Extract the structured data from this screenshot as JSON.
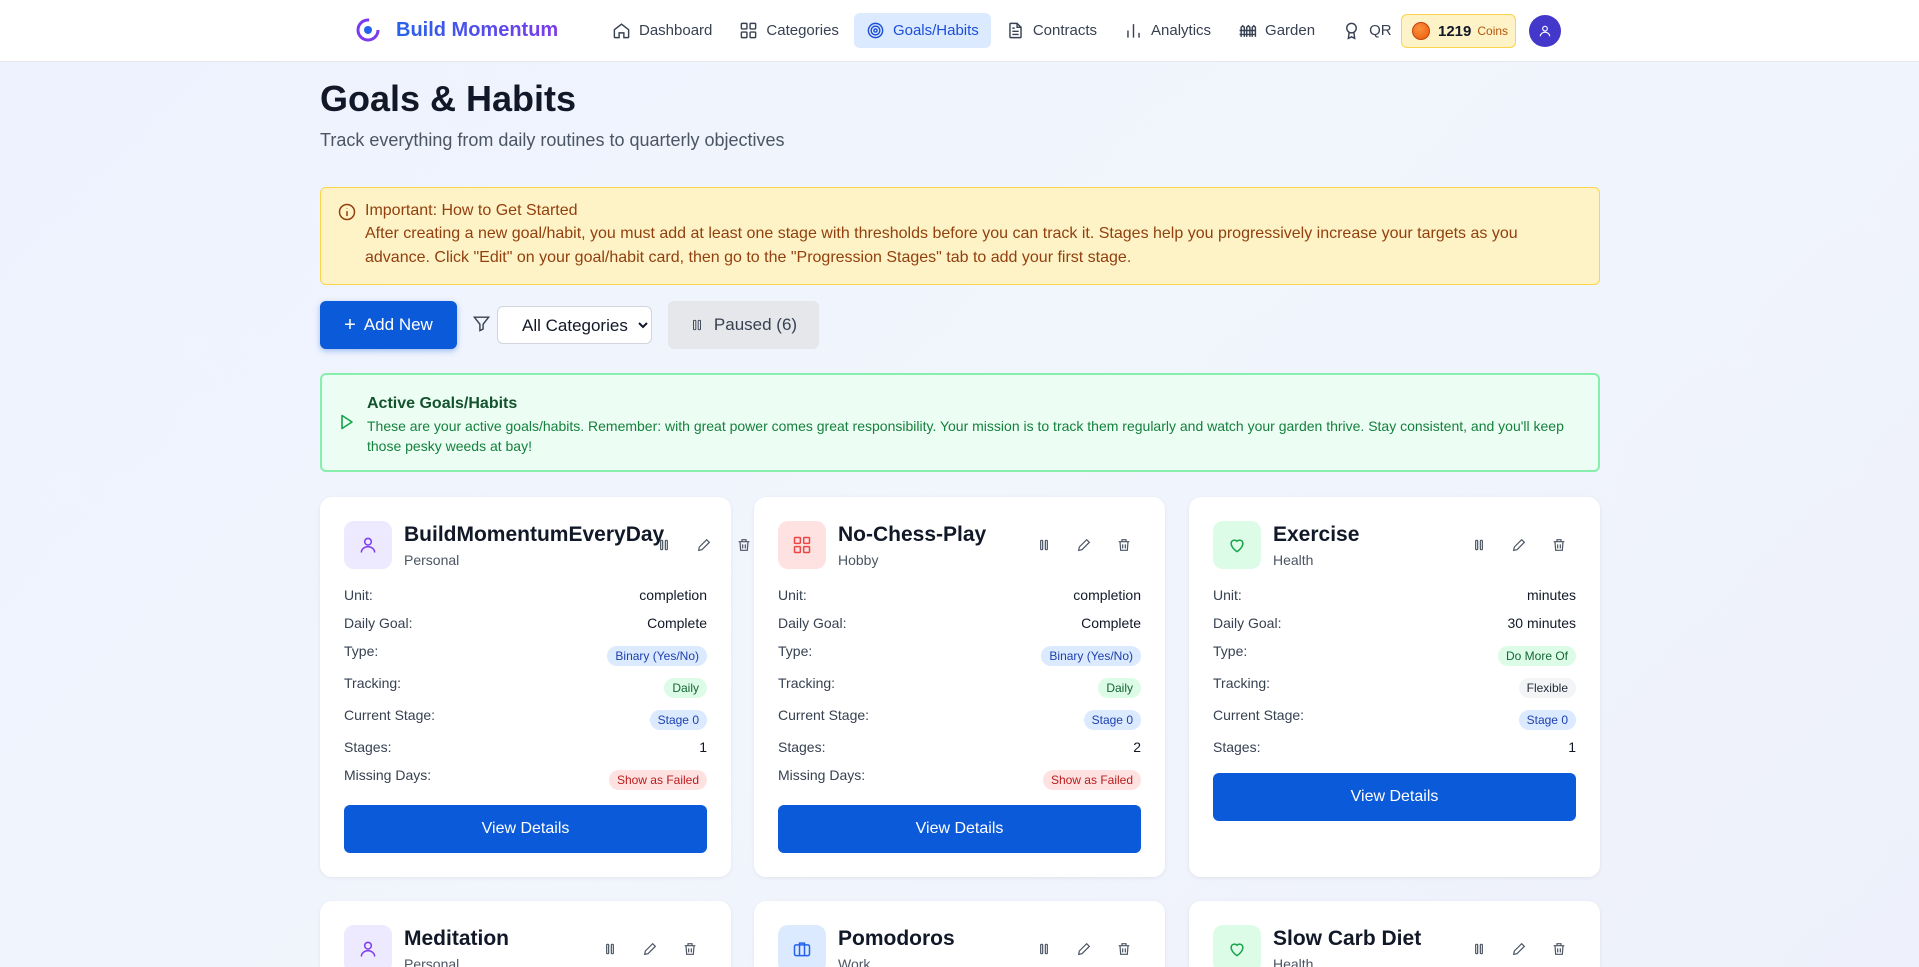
{
  "nav": {
    "brand": "Build Momentum",
    "items": [
      {
        "label": "Dashboard",
        "icon": "home-icon"
      },
      {
        "label": "Categories",
        "icon": "grid-icon"
      },
      {
        "label": "Goals/Habits",
        "icon": "target-icon"
      },
      {
        "label": "Contracts",
        "icon": "document-icon"
      },
      {
        "label": "Analytics",
        "icon": "bar-chart-icon"
      },
      {
        "label": "Garden",
        "icon": "fence-icon"
      },
      {
        "label": "QR",
        "icon": "award-icon"
      }
    ],
    "active": "Goals/Habits",
    "coins": {
      "count": "1219",
      "label": "Coins"
    }
  },
  "header": {
    "title": "Goals & Habits",
    "subtitle": "Track everything from daily routines to quarterly objectives"
  },
  "alert": {
    "title": "Important: How to Get Started",
    "text": "After creating a new goal/habit, you must add at least one stage with thresholds before you can track it. Stages help you progressively increase your targets as you advance. Click \"Edit\" on your goal/habit card, then go to the \"Progression Stages\" tab to add your first stage."
  },
  "toolbar": {
    "add_label": "Add New",
    "category_selected": "All Categories",
    "paused_label": "Paused (6)"
  },
  "banner": {
    "title": "Active Goals/Habits",
    "text": "These are your active goals/habits. Remember: with great power comes great responsibility. Your mission is to track them regularly and watch your garden thrive. Stay consistent, and you'll keep those pesky weeds at bay!"
  },
  "labels": {
    "unit": "Unit:",
    "daily_goal": "Daily Goal:",
    "type": "Type:",
    "tracking": "Tracking:",
    "current_stage": "Current Stage:",
    "stages": "Stages:",
    "missing_days": "Missing Days:",
    "view_details": "View Details"
  },
  "cards": [
    {
      "name": "BuildMomentumEveryDay",
      "category": "Personal",
      "icon": "user-icon",
      "unit": "completion",
      "daily_goal": "Complete",
      "type": "Binary (Yes/No)",
      "tracking": "Daily",
      "current_stage": "Stage 0",
      "stages": "1",
      "missing_days": "Show as Failed"
    },
    {
      "name": "No-Chess-Play",
      "category": "Hobby",
      "icon": "grid-icon",
      "unit": "completion",
      "daily_goal": "Complete",
      "type": "Binary (Yes/No)",
      "tracking": "Daily",
      "current_stage": "Stage 0",
      "stages": "2",
      "missing_days": "Show as Failed"
    },
    {
      "name": "Exercise",
      "category": "Health",
      "icon": "heart-icon",
      "unit": "minutes",
      "daily_goal": "30 minutes",
      "type": "Do More Of",
      "tracking": "Flexible",
      "current_stage": "Stage 0",
      "stages": "1"
    },
    {
      "name": "Meditation",
      "category": "Personal",
      "icon": "user-icon"
    },
    {
      "name": "Pomodoros",
      "category": "Work",
      "icon": "briefcase-icon"
    },
    {
      "name": "Slow Carb Diet",
      "category": "Health",
      "icon": "heart-icon"
    }
  ],
  "colors": {
    "accent": "#0b5ad9",
    "active_nav_bg": "#dbeafe",
    "alert_bg": "#fef3c7",
    "banner_bg": "#ecfdf3"
  }
}
